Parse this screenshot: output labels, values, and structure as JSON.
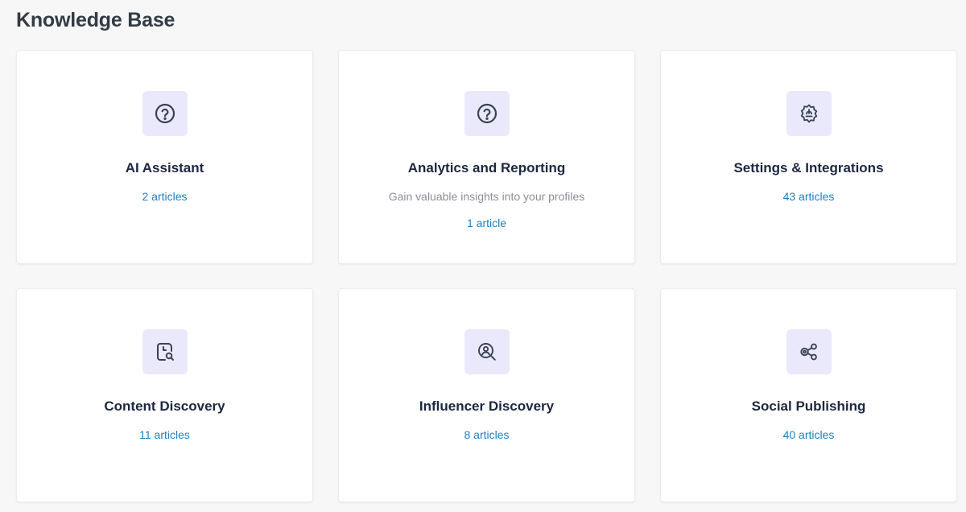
{
  "page": {
    "title": "Knowledge Base"
  },
  "colors": {
    "accent_link": "#1f7fc1",
    "icon_bg": "#e9e9fb",
    "title_text": "#1c2740",
    "icon_stroke": "#3b4150"
  },
  "categories": [
    {
      "icon": "question-circle-icon",
      "title": "AI Assistant",
      "description": "",
      "count": "2 articles"
    },
    {
      "icon": "question-circle-icon",
      "title": "Analytics and Reporting",
      "description": "Gain valuable insights into your profiles",
      "count": "1 article"
    },
    {
      "icon": "gear-badge-icon",
      "title": "Settings & Integrations",
      "description": "",
      "count": "43 articles"
    },
    {
      "icon": "document-clock-search-icon",
      "title": "Content Discovery",
      "description": "",
      "count": "11 articles"
    },
    {
      "icon": "person-search-icon",
      "title": "Influencer Discovery",
      "description": "",
      "count": "8 articles"
    },
    {
      "icon": "share-nodes-icon",
      "title": "Social Publishing",
      "description": "",
      "count": "40 articles"
    }
  ]
}
